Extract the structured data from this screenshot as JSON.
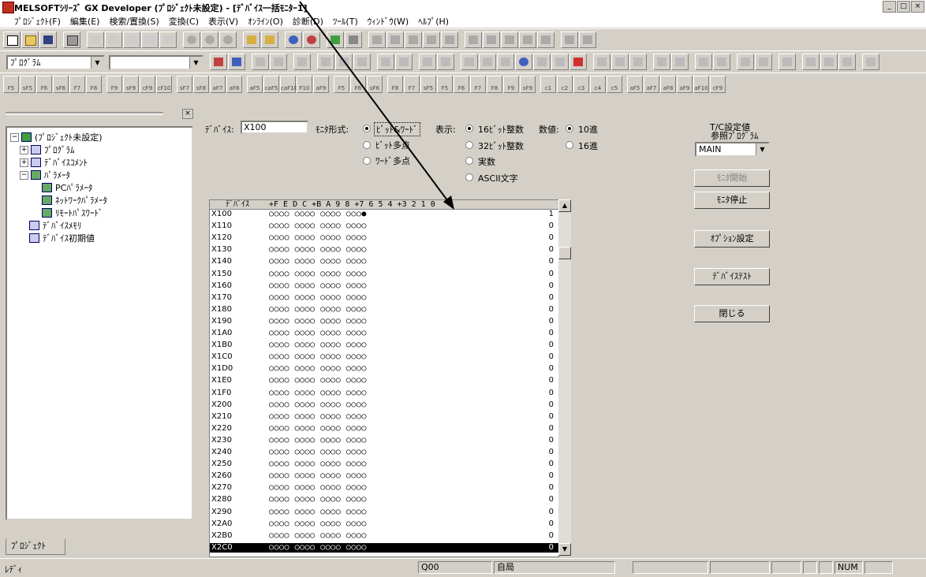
{
  "window": {
    "title": "MELSOFTｼﾘｰｽﾞ GX Developer (ﾌﾟﾛｼﾞｪｸﾄ未設定) - [ﾃﾞﾊﾞｲｽ一括ﾓﾆﾀｰ1]",
    "min": "_",
    "restore": "□",
    "close": "×"
  },
  "menu": [
    "ﾌﾟﾛｼﾞｪｸﾄ(F)",
    "編集(E)",
    "検索/置換(S)",
    "変換(C)",
    "表示(V)",
    "ｵﾝﾗｲﾝ(O)",
    "診断(D)",
    "ﾂｰﾙ(T)",
    "ｳｨﾝﾄﾞｳ(W)",
    "ﾍﾙﾌﾟ(H)"
  ],
  "toolbar": {
    "program_combo": "ﾌﾟﾛｸﾞﾗﾑ",
    "second_combo": ""
  },
  "fkeys": [
    "F5",
    "sF5",
    "F6",
    "sF6",
    "F7",
    "F8",
    "F9",
    "sF9",
    "cF9",
    "cF10",
    "sF7",
    "sF8",
    "aF7",
    "aF8",
    "aF5",
    "caF5",
    "caF10",
    "F10",
    "aF9",
    "F5",
    "F6",
    "sF6",
    "F8",
    "F7",
    "sF5",
    "F5",
    "F6",
    "F7",
    "F8",
    "F9",
    "sF9",
    "c1",
    "c2",
    "c3",
    "c4",
    "c5",
    "aF5",
    "aF7",
    "aF8",
    "aF9",
    "aF10",
    "cF9"
  ],
  "tree": {
    "root": "(ﾌﾟﾛｼﾞｪｸﾄ未設定)",
    "program": "ﾌﾟﾛｸﾞﾗﾑ",
    "device_comment": "ﾃﾞﾊﾞｲｽｺﾒﾝﾄ",
    "parameter": "ﾊﾟﾗﾒｰﾀ",
    "pc_param": "PCﾊﾟﾗﾒｰﾀ",
    "network_param": "ﾈｯﾄﾜｰｸﾊﾟﾗﾒｰﾀ",
    "remote_password": "ﾘﾓｰﾄﾊﾟｽﾜｰﾄﾞ",
    "device_memory": "ﾃﾞﾊﾞｲｽﾒﾓﾘ",
    "device_init": "ﾃﾞﾊﾞｲｽ初期値",
    "tab": "ﾌﾟﾛｼﾞｪｸﾄ"
  },
  "monitor": {
    "device_label": "ﾃﾞﾊﾞｲｽ:",
    "device_value": "X100",
    "format_label": "ﾓﾆﾀ形式:",
    "format_options": [
      "ﾋﾞｯﾄ&ﾜｰﾄﾞ",
      "ﾋﾞｯﾄ多点",
      "ﾜｰﾄﾞ多点"
    ],
    "display_label": "表示:",
    "display_options": [
      "16ﾋﾞｯﾄ整数",
      "32ﾋﾞｯﾄ整数",
      "実数",
      "ASCII文字"
    ],
    "value_label": "数値:",
    "value_options": [
      "10進",
      "16進"
    ],
    "tc_label_1": "T/C設定値",
    "tc_label_2": "参照ﾌﾟﾛｸﾞﾗﾑ",
    "tc_combo": "MAIN",
    "start_button": "ﾓﾆﾀ開始",
    "stop_button": "ﾓﾆﾀ停止",
    "option_button": "ｵﾌﾟｼｮﾝ設定",
    "device_test_button": "ﾃﾞﾊﾞｲｽﾃｽﾄ",
    "close_button": "閉じる"
  },
  "grid": {
    "headers": [
      "ﾃﾞﾊﾞｲｽ",
      "+F E D C  +B A 9 8  +7 6 5 4  +3 2 1 0"
    ],
    "rows": [
      {
        "dev": "X100",
        "bits": "○○○○ ○○○○ ○○○○ ○○○●",
        "val": "1"
      },
      {
        "dev": "X110",
        "bits": "○○○○ ○○○○ ○○○○ ○○○○",
        "val": "0"
      },
      {
        "dev": "X120",
        "bits": "○○○○ ○○○○ ○○○○ ○○○○",
        "val": "0"
      },
      {
        "dev": "X130",
        "bits": "○○○○ ○○○○ ○○○○ ○○○○",
        "val": "0"
      },
      {
        "dev": "X140",
        "bits": "○○○○ ○○○○ ○○○○ ○○○○",
        "val": "0"
      },
      {
        "dev": "X150",
        "bits": "○○○○ ○○○○ ○○○○ ○○○○",
        "val": "0"
      },
      {
        "dev": "X160",
        "bits": "○○○○ ○○○○ ○○○○ ○○○○",
        "val": "0"
      },
      {
        "dev": "X170",
        "bits": "○○○○ ○○○○ ○○○○ ○○○○",
        "val": "0"
      },
      {
        "dev": "X180",
        "bits": "○○○○ ○○○○ ○○○○ ○○○○",
        "val": "0"
      },
      {
        "dev": "X190",
        "bits": "○○○○ ○○○○ ○○○○ ○○○○",
        "val": "0"
      },
      {
        "dev": "X1A0",
        "bits": "○○○○ ○○○○ ○○○○ ○○○○",
        "val": "0"
      },
      {
        "dev": "X1B0",
        "bits": "○○○○ ○○○○ ○○○○ ○○○○",
        "val": "0"
      },
      {
        "dev": "X1C0",
        "bits": "○○○○ ○○○○ ○○○○ ○○○○",
        "val": "0"
      },
      {
        "dev": "X1D0",
        "bits": "○○○○ ○○○○ ○○○○ ○○○○",
        "val": "0"
      },
      {
        "dev": "X1E0",
        "bits": "○○○○ ○○○○ ○○○○ ○○○○",
        "val": "0"
      },
      {
        "dev": "X1F0",
        "bits": "○○○○ ○○○○ ○○○○ ○○○○",
        "val": "0"
      },
      {
        "dev": "X200",
        "bits": "○○○○ ○○○○ ○○○○ ○○○○",
        "val": "0"
      },
      {
        "dev": "X210",
        "bits": "○○○○ ○○○○ ○○○○ ○○○○",
        "val": "0"
      },
      {
        "dev": "X220",
        "bits": "○○○○ ○○○○ ○○○○ ○○○○",
        "val": "0"
      },
      {
        "dev": "X230",
        "bits": "○○○○ ○○○○ ○○○○ ○○○○",
        "val": "0"
      },
      {
        "dev": "X240",
        "bits": "○○○○ ○○○○ ○○○○ ○○○○",
        "val": "0"
      },
      {
        "dev": "X250",
        "bits": "○○○○ ○○○○ ○○○○ ○○○○",
        "val": "0"
      },
      {
        "dev": "X260",
        "bits": "○○○○ ○○○○ ○○○○ ○○○○",
        "val": "0"
      },
      {
        "dev": "X270",
        "bits": "○○○○ ○○○○ ○○○○ ○○○○",
        "val": "0"
      },
      {
        "dev": "X280",
        "bits": "○○○○ ○○○○ ○○○○ ○○○○",
        "val": "0"
      },
      {
        "dev": "X290",
        "bits": "○○○○ ○○○○ ○○○○ ○○○○",
        "val": "0"
      },
      {
        "dev": "X2A0",
        "bits": "○○○○ ○○○○ ○○○○ ○○○○",
        "val": "0"
      },
      {
        "dev": "X2B0",
        "bits": "○○○○ ○○○○ ○○○○ ○○○○",
        "val": "0"
      },
      {
        "dev": "X2C0",
        "bits": "○○○○ ○○○○ ○○○○ ○○○○",
        "val": "0"
      }
    ]
  },
  "status": {
    "ready": "ﾚﾃﾞｨ",
    "cpu": "Q00",
    "station": "自局",
    "num": "NUM"
  }
}
